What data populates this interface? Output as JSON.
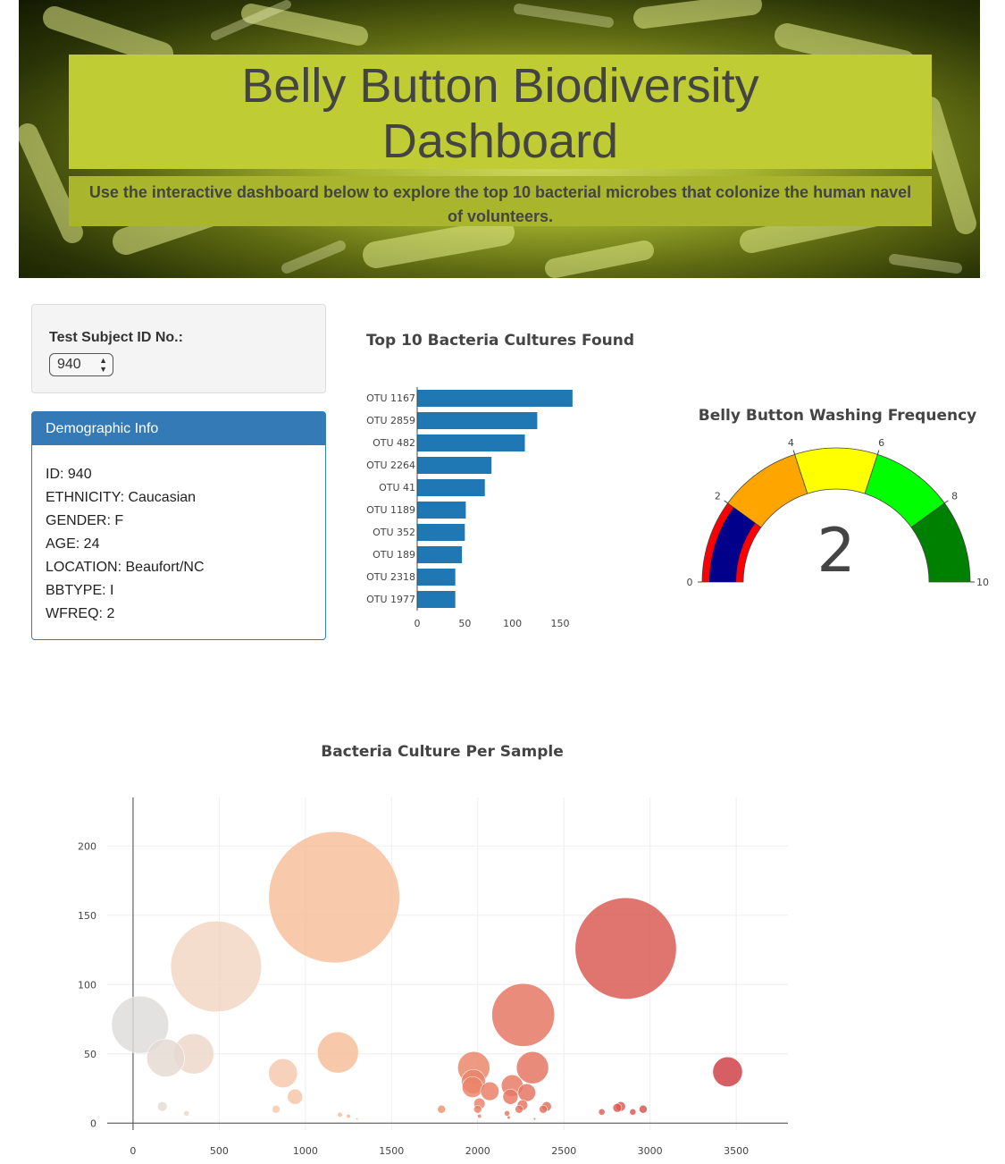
{
  "header": {
    "title_line1": "Belly Button Biodiversity",
    "title_line2": "Dashboard",
    "subtitle": "Use the interactive dashboard below to explore the top 10 bacterial microbes that colonize the human navel of volunteers."
  },
  "selector": {
    "label": "Test Subject ID No.:",
    "value": "940"
  },
  "demographic": {
    "heading": "Demographic Info",
    "rows": [
      "ID: 940",
      "ETHNICITY: Caucasian",
      "GENDER: F",
      "AGE: 24",
      "LOCATION: Beaufort/NC",
      "BBTYPE: I",
      "WFREQ: 2"
    ]
  },
  "colors": {
    "bar": "#1f77b4",
    "panel": "#337ab7",
    "title_band": "#bfcc33"
  },
  "chart_data": [
    {
      "type": "bar",
      "orientation": "horizontal",
      "title": "Top 10 Bacteria Cultures Found",
      "categories": [
        "OTU 1167",
        "OTU 2859",
        "OTU 482",
        "OTU 2264",
        "OTU 41",
        "OTU 1189",
        "OTU 352",
        "OTU 189",
        "OTU 2318",
        "OTU 1977"
      ],
      "values": [
        163,
        126,
        113,
        78,
        71,
        51,
        50,
        47,
        40,
        40
      ],
      "xticks": [
        0,
        50,
        100,
        150
      ],
      "xlim": [
        0,
        165
      ]
    },
    {
      "type": "gauge",
      "title": "Belly Button Washing Frequency",
      "value": 2,
      "range": [
        0,
        10
      ],
      "ticks": [
        0,
        2,
        4,
        6,
        8,
        10
      ],
      "steps": [
        {
          "range": [
            0,
            2
          ],
          "color": "red"
        },
        {
          "range": [
            2,
            4
          ],
          "color": "orange"
        },
        {
          "range": [
            4,
            6
          ],
          "color": "yellow"
        },
        {
          "range": [
            6,
            8
          ],
          "color": "lime"
        },
        {
          "range": [
            8,
            10
          ],
          "color": "green"
        }
      ],
      "bar_color": "darkblue"
    },
    {
      "type": "scatter",
      "mode": "bubble",
      "title": "Bacteria Culture Per Sample",
      "xticks": [
        0,
        500,
        1000,
        1500,
        2000,
        2500,
        3000,
        3500
      ],
      "yticks": [
        0,
        50,
        100,
        150,
        200
      ],
      "xlim": [
        -150,
        3800
      ],
      "ylim": [
        -5,
        235
      ],
      "colorscale": "OrRd-like",
      "points": [
        {
          "x": 41,
          "y": 71
        },
        {
          "x": 189,
          "y": 47
        },
        {
          "x": 352,
          "y": 50
        },
        {
          "x": 482,
          "y": 113
        },
        {
          "x": 1167,
          "y": 163
        },
        {
          "x": 1189,
          "y": 51
        },
        {
          "x": 2264,
          "y": 78
        },
        {
          "x": 2859,
          "y": 126
        },
        {
          "x": 2318,
          "y": 40
        },
        {
          "x": 1977,
          "y": 40
        },
        {
          "x": 3450,
          "y": 37
        },
        {
          "x": 870,
          "y": 36
        },
        {
          "x": 1975,
          "y": 30
        },
        {
          "x": 1970,
          "y": 26
        },
        {
          "x": 2070,
          "y": 23
        },
        {
          "x": 2200,
          "y": 27
        },
        {
          "x": 2285,
          "y": 22
        },
        {
          "x": 2190,
          "y": 19
        },
        {
          "x": 940,
          "y": 19
        },
        {
          "x": 2010,
          "y": 14
        },
        {
          "x": 2260,
          "y": 13
        },
        {
          "x": 2000,
          "y": 10
        },
        {
          "x": 2240,
          "y": 10
        },
        {
          "x": 170,
          "y": 12
        },
        {
          "x": 2400,
          "y": 12
        },
        {
          "x": 2380,
          "y": 10
        },
        {
          "x": 2830,
          "y": 12
        },
        {
          "x": 2810,
          "y": 11
        },
        {
          "x": 2960,
          "y": 10
        },
        {
          "x": 1790,
          "y": 10
        },
        {
          "x": 830,
          "y": 10
        },
        {
          "x": 2720,
          "y": 8
        },
        {
          "x": 2900,
          "y": 8
        },
        {
          "x": 310,
          "y": 7
        },
        {
          "x": 1200,
          "y": 6
        },
        {
          "x": 2170,
          "y": 7
        },
        {
          "x": 2180,
          "y": 4
        },
        {
          "x": 1250,
          "y": 5
        },
        {
          "x": 1300,
          "y": 3
        },
        {
          "x": 2010,
          "y": 5
        },
        {
          "x": 2330,
          "y": 3
        }
      ]
    }
  ]
}
